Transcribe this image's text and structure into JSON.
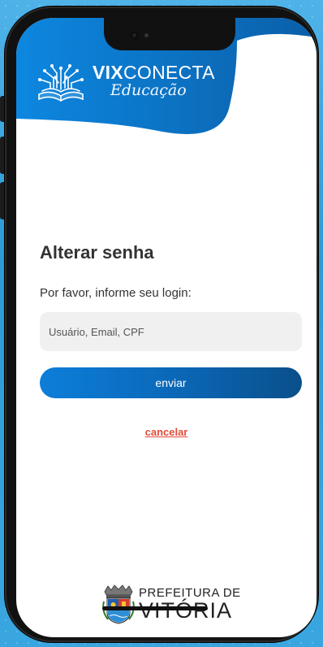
{
  "brand": {
    "name_bold": "VIX",
    "name_rest": "CONECTA",
    "subtitle": "Educação"
  },
  "form": {
    "title": "Alterar senha",
    "prompt": "Por favor, informe seu login:",
    "login_placeholder": "Usuário, Email, CPF",
    "login_value": "",
    "submit_label": "enviar",
    "cancel_label": "cancelar"
  },
  "footer": {
    "line1": "PREFEITURA DE",
    "line2": "VITÓRIA"
  },
  "colors": {
    "brand_blue": "#0d7ed9",
    "cancel_red": "#e24b3b",
    "background": "#3aa6e0"
  }
}
